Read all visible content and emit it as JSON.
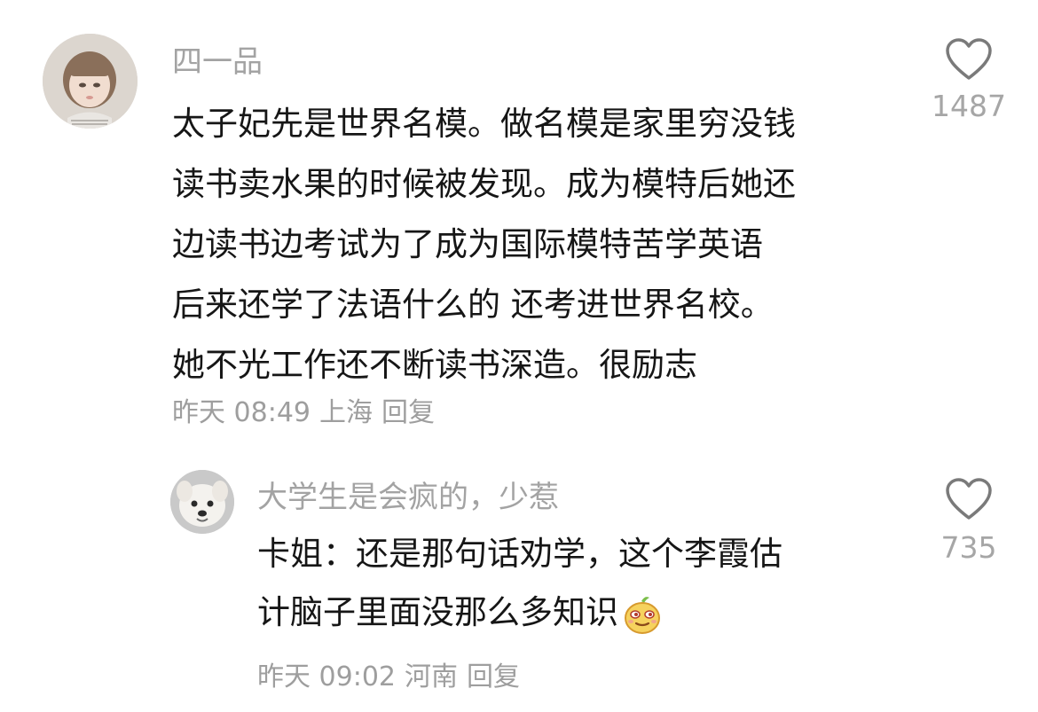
{
  "comments": [
    {
      "username": "四一品",
      "avatar": "girl-doll-avatar",
      "content_lines": [
        "太子妃先是世界名模。做名模是家里穷没钱",
        "读书卖水果的时候被发现。成为模特后她还",
        "边读书边考试为了成为国际模特苦学英语",
        "后来还学了法语什么的 还考进世界名校。",
        "她不光工作还不断读书深造。很励志"
      ],
      "time": "昨天 08:49",
      "location": "上海",
      "reply_label": "回复",
      "like_icon": "heart-outline-icon",
      "like_count": "1487"
    },
    {
      "username": "大学生是会疯的，少惹",
      "avatar": "white-dog-avatar",
      "content_lines": [
        "卡姐：还是那句话劝学，这个李霞估",
        "计脑子里面没那么多知识"
      ],
      "emoji": "smug-face-emoji",
      "time": "昨天 09:02",
      "location": "河南",
      "reply_label": "回复",
      "like_icon": "heart-outline-icon",
      "like_count": "735"
    }
  ],
  "colors": {
    "username": "#a3a3a3",
    "content": "#161616",
    "meta": "#9e9e9e",
    "like_count": "#a6a6a6",
    "heart_stroke": "#7a7a7a"
  }
}
